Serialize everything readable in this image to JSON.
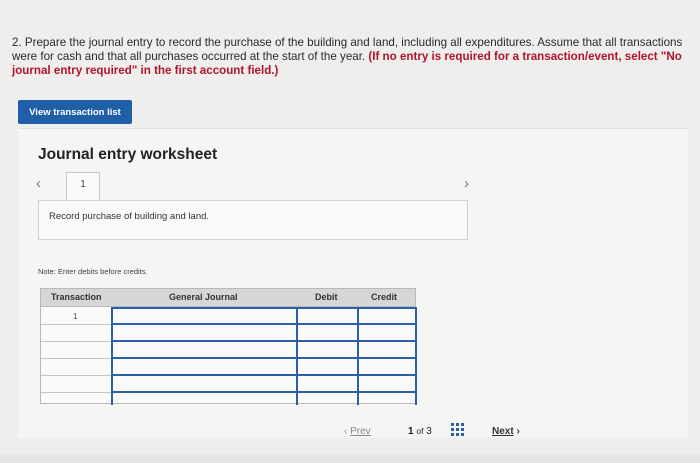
{
  "question": {
    "text": "2. Prepare the journal entry to record the purchase of the building and land, including all expenditures. Assume that all transactions were for cash and that all purchases occurred at the start of the year.",
    "warning": "(If no entry is required for a transaction/event, select \"No journal entry required\" in the first account field.)"
  },
  "buttons": {
    "view_transactions": "View transaction list"
  },
  "worksheet": {
    "title": "Journal entry worksheet",
    "tab_number": "1",
    "description": "Record purchase of building and land.",
    "note": "Note: Enter debits before credits."
  },
  "table": {
    "headers": [
      "Transaction",
      "General Journal",
      "Debit",
      "Credit"
    ],
    "rows": [
      {
        "transaction": "1",
        "account": "",
        "debit": "",
        "credit": ""
      },
      {
        "transaction": "",
        "account": "",
        "debit": "",
        "credit": ""
      },
      {
        "transaction": "",
        "account": "",
        "debit": "",
        "credit": ""
      },
      {
        "transaction": "",
        "account": "",
        "debit": "",
        "credit": ""
      },
      {
        "transaction": "",
        "account": "",
        "debit": "",
        "credit": ""
      },
      {
        "transaction": "",
        "account": "",
        "debit": "",
        "credit": ""
      }
    ]
  },
  "pager": {
    "prev": "Prev",
    "current": "1",
    "of": "of",
    "total": "3",
    "next": "Next"
  },
  "colors": {
    "accent": "#1f5fa8",
    "warning": "#b3132b"
  },
  "icons": {
    "prev_arrow": "chevron-left-icon",
    "next_arrow": "chevron-right-icon",
    "grid": "grid-icon"
  }
}
